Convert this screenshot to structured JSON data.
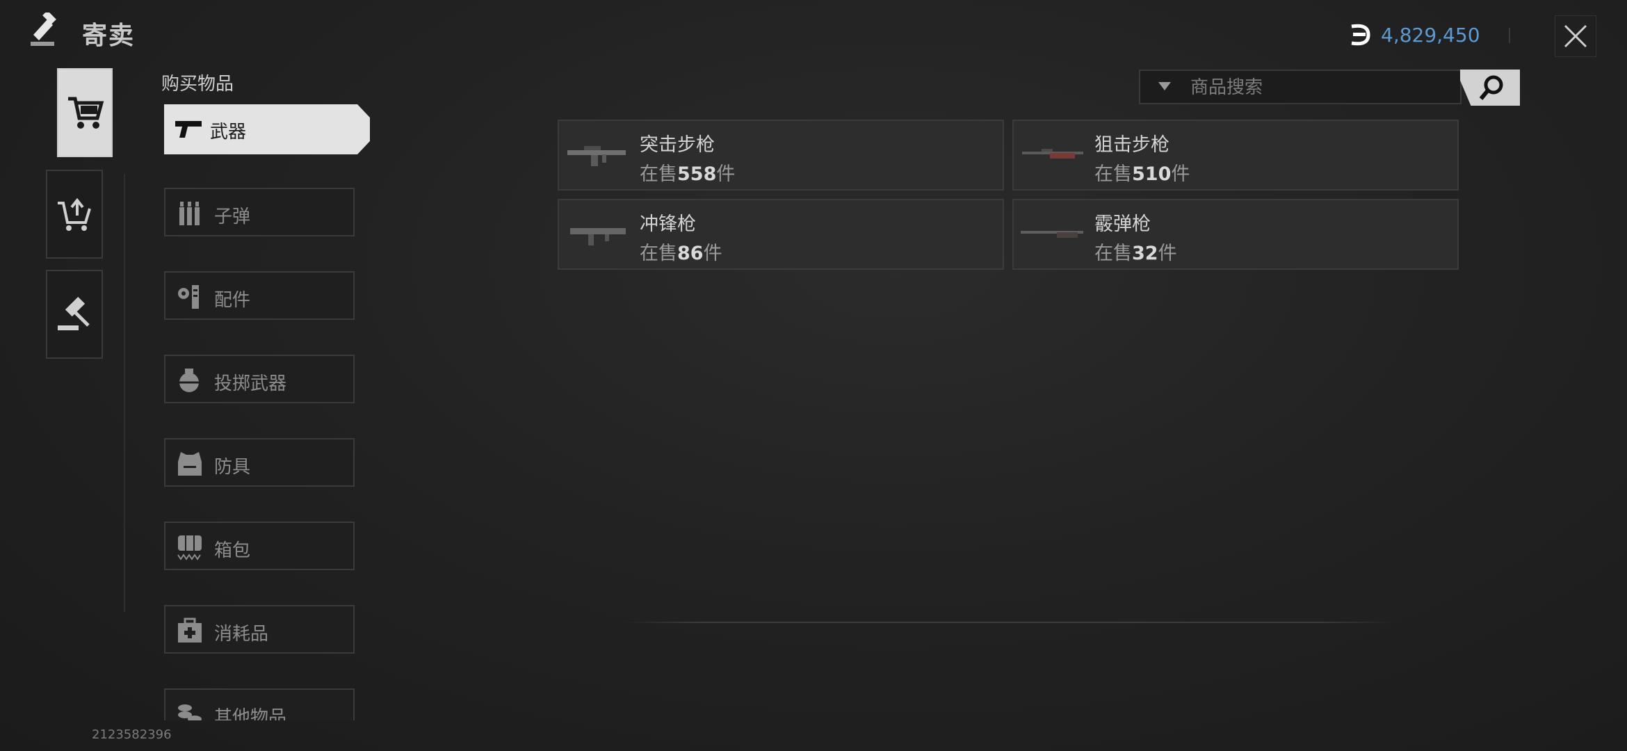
{
  "header": {
    "title": "寄卖",
    "currency_value": "4,829,450"
  },
  "side_tabs": [
    {
      "name": "buy",
      "icon": "cart-icon"
    },
    {
      "name": "sell",
      "icon": "cart-upload-icon"
    },
    {
      "name": "auction",
      "icon": "gavel-icon"
    }
  ],
  "section_title": "购买物品",
  "categories": [
    {
      "label": "武器",
      "icon": "pistol-icon"
    },
    {
      "label": "子弹",
      "icon": "ammo-icon"
    },
    {
      "label": "配件",
      "icon": "attachment-icon"
    },
    {
      "label": "投掷武器",
      "icon": "grenade-icon"
    },
    {
      "label": "防具",
      "icon": "armor-icon"
    },
    {
      "label": "箱包",
      "icon": "backpack-icon"
    },
    {
      "label": "消耗品",
      "icon": "medkit-icon"
    },
    {
      "label": "其他物品",
      "icon": "coins-icon"
    }
  ],
  "search": {
    "placeholder": "商品搜索"
  },
  "items": [
    {
      "name": "突击步枪",
      "prefix": "在售",
      "count": "558",
      "suffix": "件",
      "icon": "assault-rifle-icon"
    },
    {
      "name": "狙击步枪",
      "prefix": "在售",
      "count": "510",
      "suffix": "件",
      "icon": "sniper-rifle-icon"
    },
    {
      "name": "冲锋枪",
      "prefix": "在售",
      "count": "86",
      "suffix": "件",
      "icon": "smg-icon"
    },
    {
      "name": "霰弹枪",
      "prefix": "在售",
      "count": "32",
      "suffix": "件",
      "icon": "shotgun-icon"
    }
  ],
  "footer": {
    "uid": "2123582396"
  },
  "colors": {
    "accent_blue": "#5b9bd3",
    "active_tab": "#dadada",
    "item_bg": "#2d2d2d"
  }
}
